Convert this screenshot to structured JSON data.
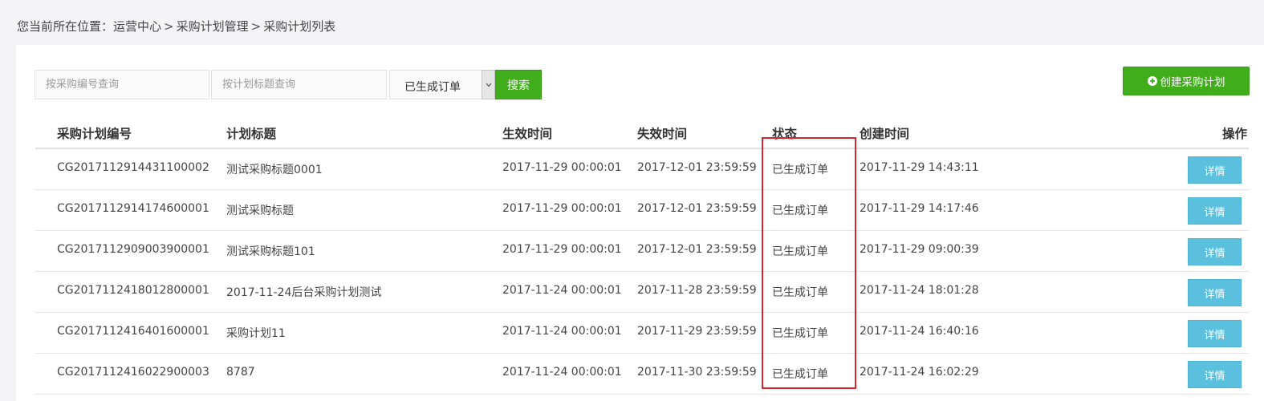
{
  "breadcrumb": {
    "prefix": "您当前所在位置：",
    "items": [
      "运营中心",
      "采购计划管理",
      "采购计划列表"
    ],
    "separator": ">"
  },
  "search": {
    "code_placeholder": "按采购编号查询",
    "title_placeholder": "按计划标题查询",
    "status_value": "已生成订单",
    "search_label": "搜索",
    "arrow_icon": "chevron-down-icon"
  },
  "toolbar": {
    "create_label": "创建采购计划",
    "create_icon": "plus-circle-icon"
  },
  "table": {
    "headers": {
      "code": "采购计划编号",
      "title": "计划标题",
      "effective": "生效时间",
      "expire": "失效时间",
      "status": "状态",
      "created": "创建时间",
      "operation": "操作"
    },
    "rows": [
      {
        "code": "CG2017112914431100002",
        "title": "测试采购标题0001",
        "effective": "2017-11-29 00:00:01",
        "expire": "2017-12-01 23:59:59",
        "status": "已生成订单",
        "created": "2017-11-29 14:43:11",
        "action": "详情"
      },
      {
        "code": "CG2017112914174600001",
        "title": "测试采购标题",
        "effective": "2017-11-29 00:00:01",
        "expire": "2017-12-01 23:59:59",
        "status": "已生成订单",
        "created": "2017-11-29 14:17:46",
        "action": "详情"
      },
      {
        "code": "CG2017112909003900001",
        "title": "测试采购标题101",
        "effective": "2017-11-29 00:00:01",
        "expire": "2017-12-01 23:59:59",
        "status": "已生成订单",
        "created": "2017-11-29 09:00:39",
        "action": "详情"
      },
      {
        "code": "CG2017112418012800001",
        "title": "2017-11-24后台采购计划测试",
        "effective": "2017-11-24 00:00:01",
        "expire": "2017-11-28 23:59:59",
        "status": "已生成订单",
        "created": "2017-11-24 18:01:28",
        "action": "详情"
      },
      {
        "code": "CG2017112416401600001",
        "title": "采购计划11",
        "effective": "2017-11-24 00:00:01",
        "expire": "2017-11-29 23:59:59",
        "status": "已生成订单",
        "created": "2017-11-24 16:40:16",
        "action": "详情"
      },
      {
        "code": "CG2017112416022900003",
        "title": "8787",
        "effective": "2017-11-24 00:00:01",
        "expire": "2017-11-30 23:59:59",
        "status": "已生成订单",
        "created": "2017-11-24 16:02:29",
        "action": "详情"
      }
    ]
  },
  "colors": {
    "accent_green": "#3fae1a",
    "detail_blue": "#5bc0de",
    "highlight_red": "#d9232d"
  }
}
